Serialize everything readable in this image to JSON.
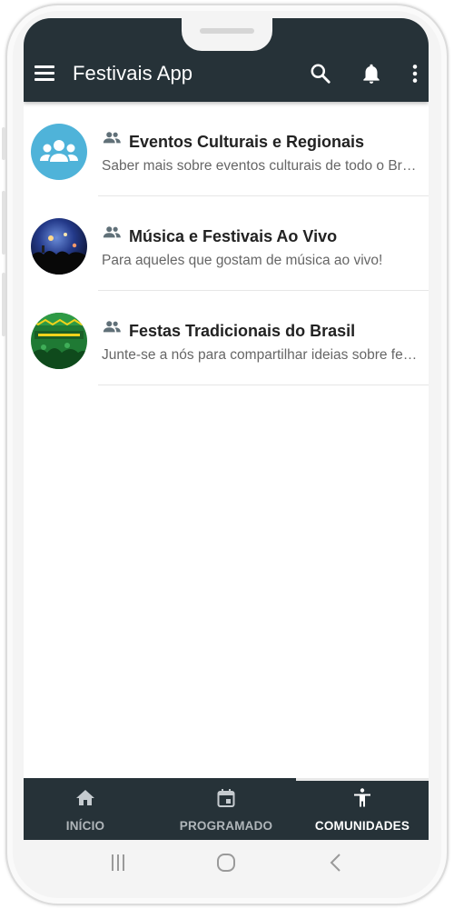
{
  "appbar": {
    "title": "Festivais App",
    "menu_icon": "menu-icon",
    "actions": [
      "search-icon",
      "bell-icon",
      "more-vert-icon"
    ]
  },
  "communities": [
    {
      "title": "Eventos Culturais e Regionais",
      "subtitle": "Saber mais sobre eventos culturais de todo o Brasil",
      "avatar": "people-group-avatar"
    },
    {
      "title": "Música e Festivais Ao Vivo",
      "subtitle": "Para aqueles que gostam de música ao vivo!",
      "avatar": "concert-photo-avatar"
    },
    {
      "title": "Festas Tradicionais do Brasil",
      "subtitle": "Junte-se a nós para compartilhar ideias sobre festas tradicionais",
      "avatar": "carnival-photo-avatar"
    }
  ],
  "bottom_nav": {
    "items": [
      {
        "label": "INÍCIO",
        "icon": "home-icon"
      },
      {
        "label": "PROGRAMADO",
        "icon": "calendar-icon"
      },
      {
        "label": "COMUNIDADES",
        "icon": "accessibility-icon"
      }
    ],
    "active_index": 2
  },
  "colors": {
    "appbar": "#263238",
    "accent_avatar": "#4fb3d9",
    "active_label": "#ffffff",
    "inactive_label": "#b0b6ba"
  }
}
